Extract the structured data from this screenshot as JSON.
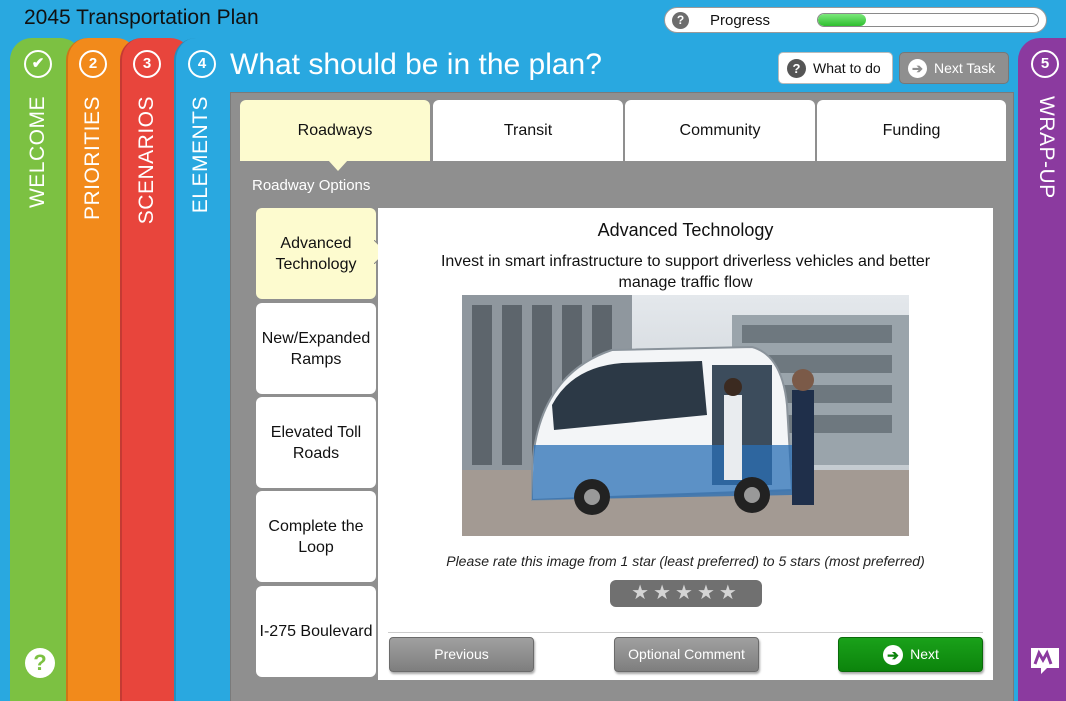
{
  "app": {
    "title": "2045 Transportation Plan"
  },
  "progress": {
    "help_icon": "?",
    "label": "Progress",
    "value": 0.22
  },
  "steps": {
    "welcome": {
      "number": "✔",
      "label": "WELCOME"
    },
    "priorities": {
      "number": "2",
      "label": "PRIORITIES"
    },
    "scenarios": {
      "number": "3",
      "label": "SCENARIOS"
    },
    "elements": {
      "number": "4",
      "label": "ELEMENTS"
    },
    "wrapup": {
      "number": "5",
      "label": "WRAP-UP"
    }
  },
  "header": {
    "page_title": "What should be in the plan?",
    "what_to_do_label": "What to do",
    "what_to_do_icon": "?",
    "next_task_label": "Next Task",
    "next_task_icon": "➔"
  },
  "categories": [
    {
      "label": "Roadways",
      "active": true
    },
    {
      "label": "Transit"
    },
    {
      "label": "Community"
    },
    {
      "label": "Funding"
    }
  ],
  "options_label": "Roadway Options",
  "options": [
    {
      "label": "Advanced Technology",
      "active": true
    },
    {
      "label": "New/Expanded Ramps"
    },
    {
      "label": "Elevated Toll Roads"
    },
    {
      "label": "Complete the Loop"
    },
    {
      "label": "I-275 Boulevard"
    }
  ],
  "content": {
    "title": "Advanced Technology",
    "description": "Invest in smart infrastructure to support driverless vehicles and better manage traffic flow",
    "rate_text": "Please rate this image from 1 star (least preferred) to 5 stars (most preferred)",
    "stars": "★★★★★",
    "rating": 0
  },
  "footer": {
    "previous_label": "Previous",
    "comment_label": "Optional Comment",
    "next_label": "Next",
    "next_icon": "➔"
  },
  "bottom_help_icon": "?",
  "colors": {
    "welcome": "#7cc142",
    "priorities": "#f28a1b",
    "scenarios": "#e8453c",
    "elements": "#29a8e0",
    "wrapup": "#8b3a9f",
    "active_tab": "#fdfbcf",
    "next_button": "#0c840c"
  }
}
